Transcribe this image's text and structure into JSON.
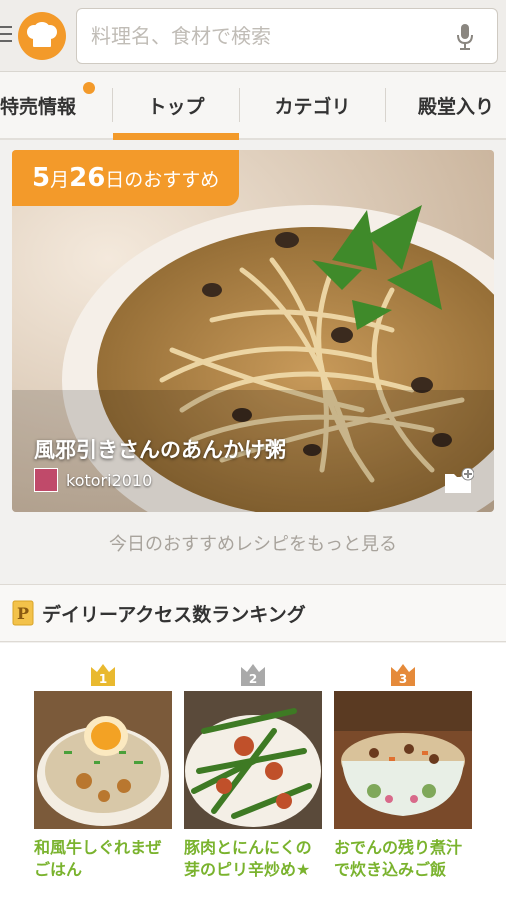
{
  "search": {
    "placeholder": "料理名、食材で検索"
  },
  "tabs": [
    {
      "label": "特売情報"
    },
    {
      "label": "トップ"
    },
    {
      "label": "カテゴリ"
    },
    {
      "label": "殿堂入り"
    }
  ],
  "featured": {
    "month": "5",
    "month_unit": "月",
    "day": "26",
    "badge_suffix": "日のおすすめ",
    "title": "風邪引きさんのあんかけ粥",
    "author": "kotori2010"
  },
  "more_link": "今日のおすすめレシピをもっと見る",
  "ranking": {
    "title": "デイリーアクセス数ランキング",
    "badge_letter": "P",
    "items": [
      {
        "rank": "1",
        "name": "和風牛しぐれまぜごはん"
      },
      {
        "rank": "2",
        "name": "豚肉とにんにくの芽のピリ辛炒め★"
      },
      {
        "rank": "3",
        "name": "おでんの残り煮汁で炊き込みご飯"
      }
    ]
  },
  "colors": {
    "accent": "#f39a2a",
    "recipe_link": "#7ab32e",
    "gold": "#e9b92f",
    "silver": "#a9a9a9",
    "bronze": "#e58a3a"
  },
  "icons": [
    "menu-icon",
    "chef-hat-icon",
    "mic-icon",
    "folder-add-icon",
    "crown-icon"
  ]
}
